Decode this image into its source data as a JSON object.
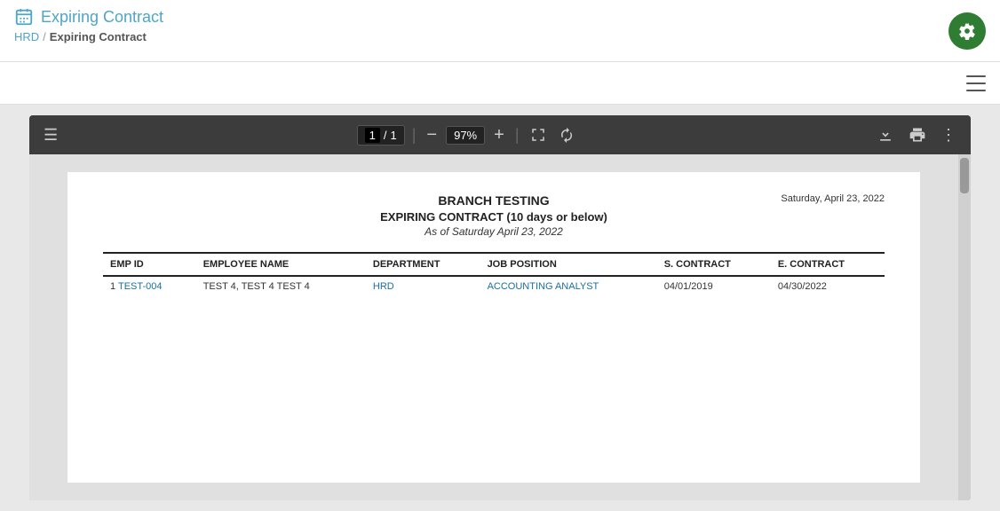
{
  "header": {
    "title": "Expiring Contract",
    "icon": "calendar-icon",
    "breadcrumb": {
      "parent": "HRD",
      "separator": "/",
      "current": "Expiring Contract"
    }
  },
  "gear_button": {
    "label": "settings",
    "aria": "Settings"
  },
  "toolbar": {
    "menu_icon": "≡"
  },
  "pdf_viewer": {
    "page_current": "1",
    "page_separator": "/",
    "page_total": "1",
    "zoom": "97%",
    "download_label": "Download",
    "print_label": "Print",
    "more_label": "More"
  },
  "document": {
    "company": "BRANCH TESTING",
    "report_title": "EXPIRING CONTRACT (10 days or below)",
    "report_subtitle": "As of Saturday April 23, 2022",
    "date": "Saturday, April 23, 2022",
    "table": {
      "columns": [
        "EMP ID",
        "EMPLOYEE NAME",
        "DEPARTMENT",
        "JOB POSITION",
        "S. CONTRACT",
        "E. CONTRACT"
      ],
      "rows": [
        {
          "num": "1",
          "emp_id": "TEST-004",
          "name": "TEST 4, TEST 4 TEST 4",
          "department": "HRD",
          "job_position": "ACCOUNTING ANALYST",
          "s_contract": "04/01/2019",
          "e_contract": "04/30/2022"
        }
      ]
    }
  }
}
